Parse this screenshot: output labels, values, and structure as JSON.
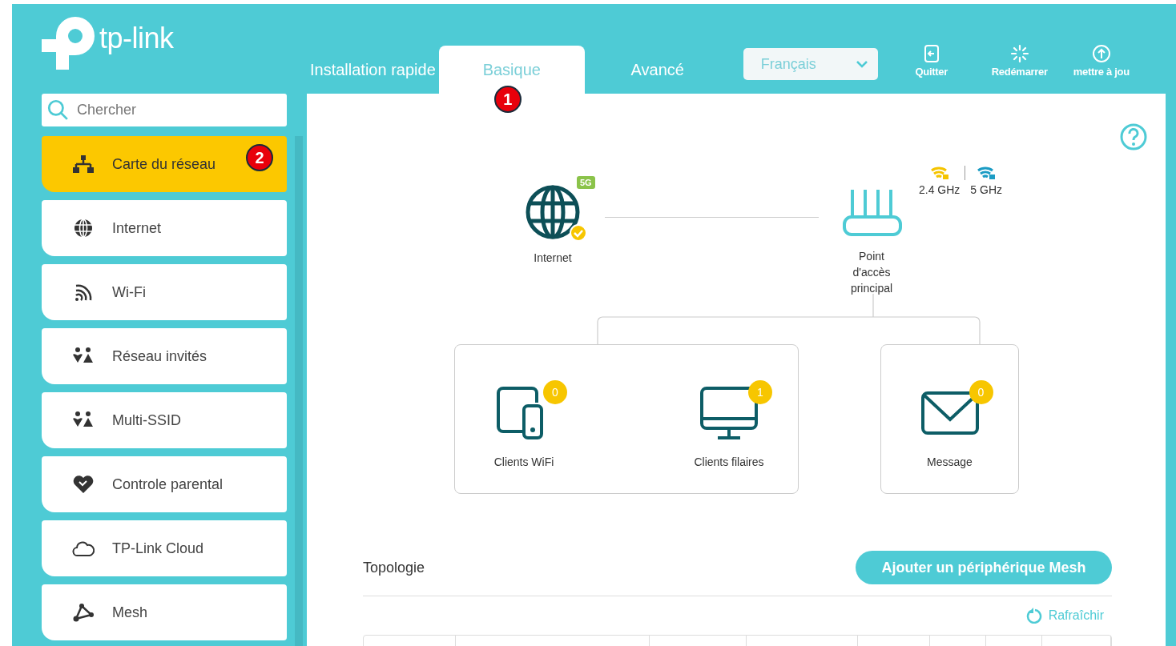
{
  "logo": {
    "text": "tp-link"
  },
  "tabs": [
    {
      "label": "Installation rapide",
      "selected": false
    },
    {
      "label": "Basique",
      "selected": true,
      "callout": "1"
    },
    {
      "label": "Avancé",
      "selected": false
    }
  ],
  "language_select": {
    "value": "Français"
  },
  "toolbar_buttons": [
    {
      "label": "Quitter",
      "kind": "logout"
    },
    {
      "label": "Redémarrer",
      "kind": "restart"
    },
    {
      "label": "mettre à jou",
      "kind": "update"
    }
  ],
  "search": {
    "placeholder": "Chercher"
  },
  "sidebar": {
    "items": [
      {
        "label": "Carte du réseau",
        "kind": "network",
        "selected": true,
        "callout": "2"
      },
      {
        "label": "Internet",
        "kind": "globe",
        "selected": false
      },
      {
        "label": "Wi-Fi",
        "kind": "wifi",
        "selected": false
      },
      {
        "label": "Réseau invités",
        "kind": "people",
        "selected": false
      },
      {
        "label": "Multi-SSID",
        "kind": "people",
        "selected": false
      },
      {
        "label": "Controle parental",
        "kind": "heart",
        "selected": false
      },
      {
        "label": "TP-Link Cloud",
        "kind": "cloud",
        "selected": false
      },
      {
        "label": "Mesh",
        "kind": "nodes",
        "selected": false
      }
    ]
  },
  "network_map": {
    "internet": {
      "label": "Internet",
      "badge": "5G",
      "connected": true
    },
    "router": {
      "label": "Point d'accès principal",
      "bands": [
        {
          "label": "2.4 GHz",
          "color": "#f5c400"
        },
        {
          "label": "5 GHz",
          "color": "#1c9cc4"
        }
      ]
    },
    "clients": [
      {
        "label": "Clients WiFi",
        "count": "0",
        "kind": "wireless"
      },
      {
        "label": "Clients filaires",
        "count": "1",
        "kind": "wired"
      }
    ],
    "message": {
      "label": "Message",
      "count": "0"
    }
  },
  "topology": {
    "title": "Topologie",
    "add_button": "Ajouter un périphérique Mesh",
    "refresh": "Rafraîchir"
  }
}
